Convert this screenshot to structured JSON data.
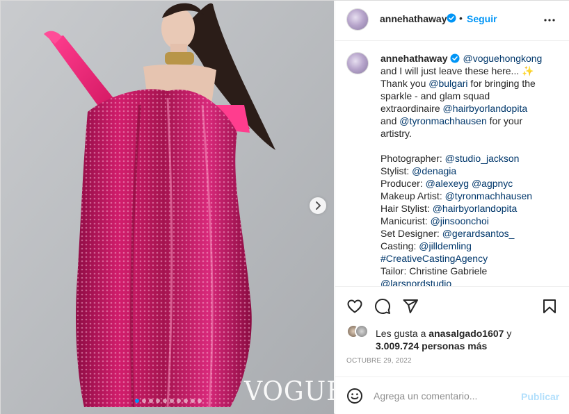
{
  "post": {
    "media": {
      "watermark": "VOGUE",
      "carousel_dot_count": 10,
      "carousel_active_index": 0,
      "next_icon": "chevron-right-icon"
    },
    "header": {
      "username": "annehathaway",
      "verified_icon": "verified-badge-icon",
      "separator": "•",
      "follow_label": "Seguir",
      "more_icon": "more-horizontal-icon"
    },
    "caption": {
      "username": "annehathaway",
      "lines": [
        [
          {
            "t": "@voguehongkong",
            "link": true
          }
        ],
        [
          {
            "t": "and I will just leave these here... "
          },
          {
            "t": "✨",
            "sparkle": true
          }
        ],
        [
          {
            "t": "Thank you "
          },
          {
            "t": "@bulgari",
            "link": true
          },
          {
            "t": " for bringing the"
          }
        ],
        [
          {
            "t": "sparkle - and glam squad"
          }
        ],
        [
          {
            "t": "extraordinaire "
          },
          {
            "t": "@hairbyorlandopita",
            "link": true
          }
        ],
        [
          {
            "t": "and "
          },
          {
            "t": "@tyronmachhausen",
            "link": true
          },
          {
            "t": " for your"
          }
        ],
        [
          {
            "t": "artistry."
          }
        ],
        [],
        [
          {
            "t": "Photographer: "
          },
          {
            "t": "@studio_jackson",
            "link": true
          }
        ],
        [
          {
            "t": "Stylist: "
          },
          {
            "t": "@denagia",
            "link": true
          }
        ],
        [
          {
            "t": "Producer: "
          },
          {
            "t": "@alexeyg",
            "link": true
          },
          {
            "t": " "
          },
          {
            "t": "@agpnyc",
            "link": true
          }
        ],
        [
          {
            "t": "Makeup Artist: "
          },
          {
            "t": "@tyronmachhausen",
            "link": true
          }
        ],
        [
          {
            "t": "Hair Stylist: "
          },
          {
            "t": "@hairbyorlandopita",
            "link": true
          }
        ],
        [
          {
            "t": "Manicurist: "
          },
          {
            "t": "@jinsoonchoi",
            "link": true
          }
        ],
        [
          {
            "t": "Set Designer: "
          },
          {
            "t": "@gerardsantos_",
            "link": true
          }
        ],
        [
          {
            "t": "Casting: "
          },
          {
            "t": "@jilldemling",
            "link": true
          }
        ],
        [
          {
            "t": "#CreativeCastingAgency",
            "link": true
          }
        ],
        [
          {
            "t": "Tailor: Christine Gabriele"
          }
        ],
        [
          {
            "t": "@larsnordstudio",
            "link": true
          }
        ]
      ]
    },
    "actions": {
      "like_icon": "heart-icon",
      "comment_icon": "comment-bubble-icon",
      "share_icon": "paper-plane-icon",
      "save_icon": "bookmark-icon"
    },
    "likes": {
      "prefix": "Les gusta a ",
      "first_liker": "anasalgado1607",
      "connector": " y",
      "others": "3.009.724 personas más"
    },
    "date": "OCTUBRE 29, 2022",
    "comment_box": {
      "emoji_icon": "emoji-smiley-icon",
      "placeholder": "Agrega un comentario...",
      "publish_label": "Publicar"
    },
    "colors": {
      "accent": "#0095f6",
      "link": "#00376b",
      "publish_disabled": "#b2dffc",
      "muted": "#8e8e8e",
      "dress": "#c4155f"
    }
  }
}
